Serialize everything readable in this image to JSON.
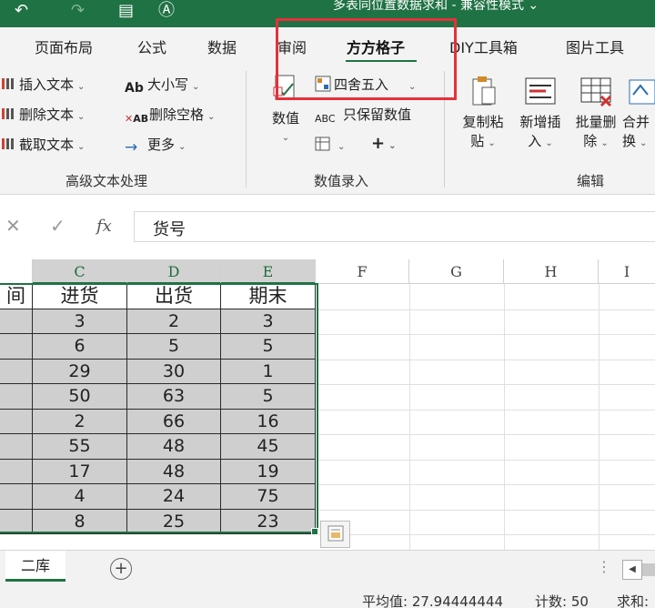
{
  "title_bar": {
    "title": "多表同位置数据求和 - 兼容性模式",
    "dropdown_glyph": "⌄"
  },
  "tabs": [
    {
      "label": "页面布局"
    },
    {
      "label": "公式"
    },
    {
      "label": "数据"
    },
    {
      "label": "审阅"
    },
    {
      "label": "方方格子",
      "active": true
    },
    {
      "label": "DIY工具箱"
    },
    {
      "label": "图片工具"
    }
  ],
  "ribbon": {
    "text_group": {
      "insert": "插入文本",
      "delete": "删除文本",
      "extract": "截取文本",
      "case": "大小写",
      "remove_space": "删除空格",
      "more": "更多",
      "label": "高级文本处理"
    },
    "value_group": {
      "numeric": "数值",
      "round": "四舍五入",
      "keep_value": "只保留数值",
      "label": "数值录入"
    },
    "edit_group": {
      "copy_paste": [
        "复制粘",
        "贴"
      ],
      "add_insert": [
        "新增插",
        "入"
      ],
      "batch_delete": [
        "批量删",
        "除"
      ],
      "merge": [
        "合并",
        "换"
      ],
      "label": "编辑"
    }
  },
  "formula_bar": {
    "value": "货号"
  },
  "grid": {
    "columns": [
      "C",
      "D",
      "E",
      "F",
      "G",
      "H",
      "I"
    ],
    "selected_columns": [
      "C",
      "D",
      "E"
    ],
    "left_partial_header": "间",
    "headers": [
      "进货",
      "出货",
      "期末"
    ],
    "rows": [
      [
        "3",
        "2",
        "3"
      ],
      [
        "6",
        "5",
        "5"
      ],
      [
        "29",
        "30",
        "1"
      ],
      [
        "50",
        "63",
        "5"
      ],
      [
        "2",
        "66",
        "16"
      ],
      [
        "55",
        "48",
        "45"
      ],
      [
        "17",
        "48",
        "19"
      ],
      [
        "4",
        "24",
        "75"
      ],
      [
        "8",
        "25",
        "23"
      ]
    ]
  },
  "sheet_tabs": {
    "active": "二库",
    "add": "+"
  },
  "status_bar": {
    "average": "平均值: 27.94444444",
    "count": "计数: 50",
    "sum": "求和:"
  },
  "colors": {
    "accent": "#1f7244",
    "highlight": "#e5303a"
  }
}
